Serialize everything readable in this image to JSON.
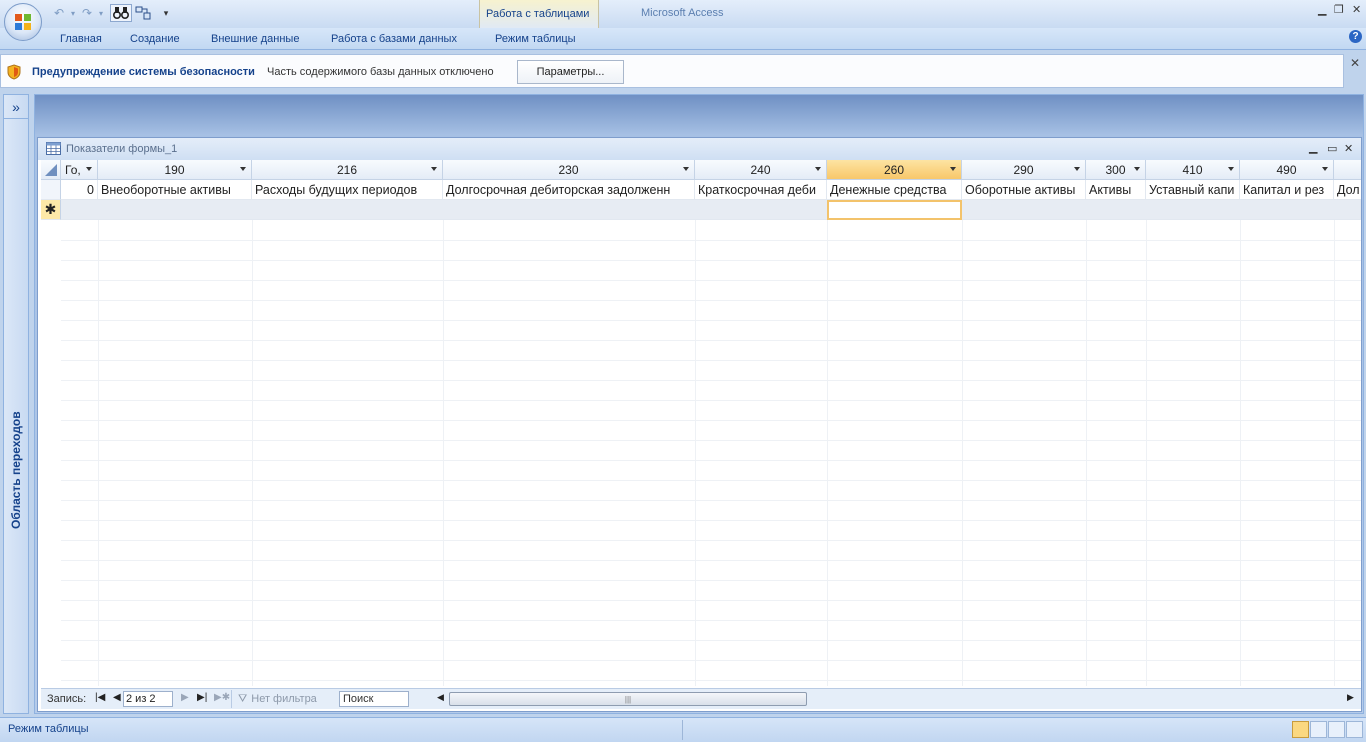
{
  "app": {
    "title": "Microsoft Access",
    "context_tab_group": "Работа с таблицами"
  },
  "ribbon": {
    "tabs": [
      "Главная",
      "Создание",
      "Внешние данные",
      "Работа с базами данных",
      "Режим таблицы"
    ]
  },
  "security": {
    "title": "Предупреждение системы безопасности",
    "message": "Часть содержимого базы данных отключено",
    "button": "Параметры..."
  },
  "nav_pane": {
    "label": "Область переходов",
    "toggle": "»"
  },
  "datasheet": {
    "title": "Показатели формы_1",
    "columns": [
      {
        "label": "Го,",
        "value": "0"
      },
      {
        "label": "190",
        "value": "Внеоборотные активы"
      },
      {
        "label": "216",
        "value": "Расходы будущих периодов"
      },
      {
        "label": "230",
        "value": "Долгосрочная дебиторская задолженн"
      },
      {
        "label": "240",
        "value": "Краткосрочная деби"
      },
      {
        "label": "260",
        "value": "Денежные средства"
      },
      {
        "label": "290",
        "value": "Оборотные активы"
      },
      {
        "label": "300",
        "value": "Активы"
      },
      {
        "label": "410",
        "value": "Уставный капи"
      },
      {
        "label": "490",
        "value": "Капитал и рез"
      },
      {
        "label": "",
        "value": "Дол"
      }
    ],
    "new_row_marker": "✱"
  },
  "record_nav": {
    "label": "Запись:",
    "position": "2 из 2",
    "filter": "Нет фильтра",
    "search_placeholder": "Поиск"
  },
  "status": {
    "text": "Режим таблицы"
  },
  "colors": {
    "accent": "#15428b",
    "selected_header": "#f8c76a"
  }
}
